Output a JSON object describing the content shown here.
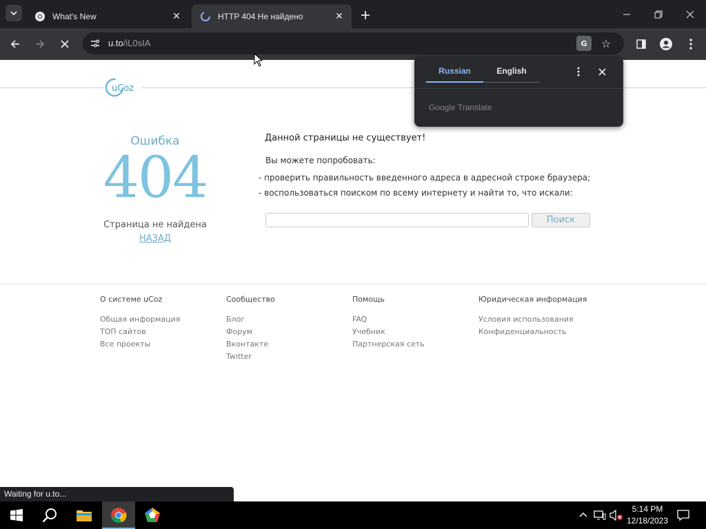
{
  "tabs": [
    {
      "title": "What's New",
      "favicon": "chrome-icon"
    },
    {
      "title": "HTTP 404 Не найдено",
      "favicon": "loading-icon"
    }
  ],
  "toolbar": {
    "url_host": "u.to",
    "url_path": "/iL0sIA",
    "translate_label": "G"
  },
  "page": {
    "error_word": "Ошибка",
    "error_code": "404",
    "error_subtitle": "Страница не найдена",
    "back_link": "НАЗАД",
    "message_title": "Данной страницы не существует!",
    "message_try": "Вы можете попробовать:",
    "suggestions": [
      "- проверить правильность введенного адреса в адресной строке браузера;",
      "- воспользоваться поиском по всему интернету и найти то, что искали:"
    ],
    "search_placeholder": "",
    "search_button": "Поиск",
    "footer": [
      {
        "heading": "О системе uCoz",
        "links": [
          "Общая информация",
          "ТОП сайтов",
          "Все проекты"
        ]
      },
      {
        "heading": "Сообщество",
        "links": [
          "Блог",
          "Форум",
          "Вконтакте",
          "Twitter"
        ]
      },
      {
        "heading": "Помощь",
        "links": [
          "FAQ",
          "Учебник",
          "Партнерская сеть"
        ]
      },
      {
        "heading": "Юридическая информация",
        "links": [
          "Условия использования",
          "Конфиденциальность"
        ]
      }
    ]
  },
  "translate_bubble": {
    "lang_source": "Russian",
    "lang_target": "English",
    "brand": "Google Translate"
  },
  "status_text": "Waiting for u.to...",
  "clock": {
    "time": "5:14 PM",
    "date": "12/18/2023"
  },
  "colors": {
    "accent_blue": "#8ab4f8",
    "ucoz_blue": "#7ec3df",
    "chrome_dark": "#202124",
    "taskbar": "#000000"
  }
}
